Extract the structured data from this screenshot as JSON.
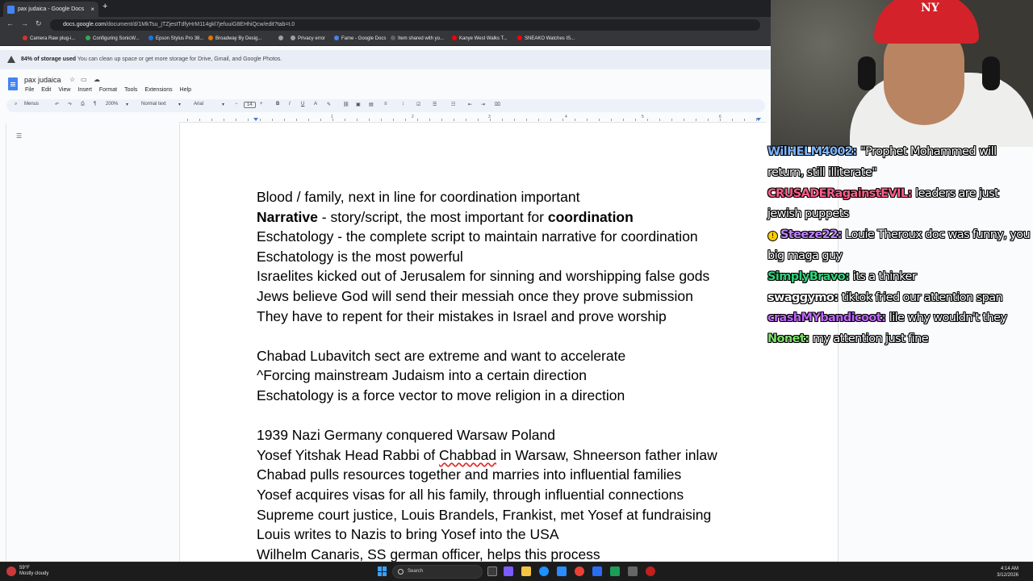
{
  "browser": {
    "tab_title": "pax judaica - Google Docs",
    "new_tab": "+",
    "tab_close": "×",
    "url_host": "docs.google.com",
    "url_path": "/document/d/1MkTsu_jTZjestTdfyHrM114gkl7jefuuiG8EHhiQcw/edit?tab=t.0",
    "bookmarks": [
      {
        "label": "Camera Raw plug-i...",
        "color": "#d93025"
      },
      {
        "label": "Configuring SonicW...",
        "color": "#34a853"
      },
      {
        "label": "Epson Stylus Pro 38...",
        "color": "#1a73e8"
      },
      {
        "label": "Broadway By Desig...",
        "color": "#e37400"
      },
      {
        "label": "",
        "color": "#9aa0a6"
      },
      {
        "label": "Privacy error",
        "color": "#9aa0a6"
      },
      {
        "label": "Fame - Google Docs",
        "color": "#4285f4"
      },
      {
        "label": "Item shared with yo...",
        "color": "#5f6368"
      },
      {
        "label": "Kanye West Walks T...",
        "color": "#ff0000"
      },
      {
        "label": "SNEAKO Watches IS...",
        "color": "#ff0000"
      }
    ]
  },
  "banner": {
    "bold": "84% of storage used",
    "text": "You can clean up space or get more storage for Drive, Gmail, and Google Photos."
  },
  "docs": {
    "title": "pax judaica",
    "menus": [
      "File",
      "Edit",
      "View",
      "Insert",
      "Format",
      "Tools",
      "Extensions",
      "Help"
    ],
    "toolbar": {
      "menus_label": "Menus",
      "zoom": "200%",
      "style": "Normal text",
      "font": "Arial",
      "size": "14"
    },
    "ruler_numbers": [
      "1",
      "1",
      "2",
      "3",
      "4",
      "5",
      "6"
    ]
  },
  "document": {
    "lines": [
      "Blood / family, next in line for coordination important",
      {
        "b1": "Narrative",
        "t1": " - story/script, the most important for ",
        "b2": "coordination"
      },
      "Eschatology - the complete script to maintain narrative for coordination",
      "Eschatology is the most powerful",
      "Israelites kicked out of Jerusalem for sinning and worshipping false gods",
      "Jews believe God will send their messiah once they prove submission",
      "They have to repent for their mistakes in Israel and prove worship",
      "",
      "Chabad Lubavitch sect are extreme and want to accelerate",
      "^Forcing mainstream Judaism into a certain direction",
      "Eschatology is a force vector to move religion in a direction",
      "",
      "1939 Nazi Germany conquered Warsaw Poland",
      {
        "pre": "Yosef Yitshak Head Rabbi of ",
        "spell": "Chabbad",
        "post": " in Warsaw, Shneerson father inlaw"
      },
      "Chabad pulls resources together and marries into influential families",
      "Yosef acquires visas for all his family, through influential connections",
      "Supreme court justice, Louis Brandels, Frankist, met Yosef at fundraising",
      "Louis writes to Nazis to bring Yosef into the USA",
      "Wilhelm Canaris, SS german officer, helps this process"
    ]
  },
  "webcam": {
    "cap_logo": "NY"
  },
  "chat": [
    {
      "user": "WilHELM4002",
      "color": "#7fb6ff",
      "text": "\"Prophet Mohammed will return, still illiterate\""
    },
    {
      "user": "CRUSADERagainstEVIL",
      "color": "#ff5c8a",
      "text": "leaders are just jewish puppets"
    },
    {
      "user": "Steeze22",
      "color": "#c084fc",
      "badge": "!",
      "text": "Louie Theroux doc was funny, you big maga guy"
    },
    {
      "user": "SimplyBravo",
      "color": "#2fd47a",
      "text": "its a thinker"
    },
    {
      "user": "swaggymo",
      "color": "#ffffff",
      "text": "tiktok fried our attention span"
    },
    {
      "user": "crashMYbandicoot",
      "color": "#c065ff",
      "text": "lile why wouldn't they"
    },
    {
      "user": "Nonet",
      "color": "#7ee06b",
      "text": "my attention just fine"
    }
  ],
  "taskbar": {
    "temp": "59°F",
    "weather": "Mostly cloudy",
    "search": "Search",
    "time": "4:14 AM",
    "date": "3/12/2026"
  }
}
